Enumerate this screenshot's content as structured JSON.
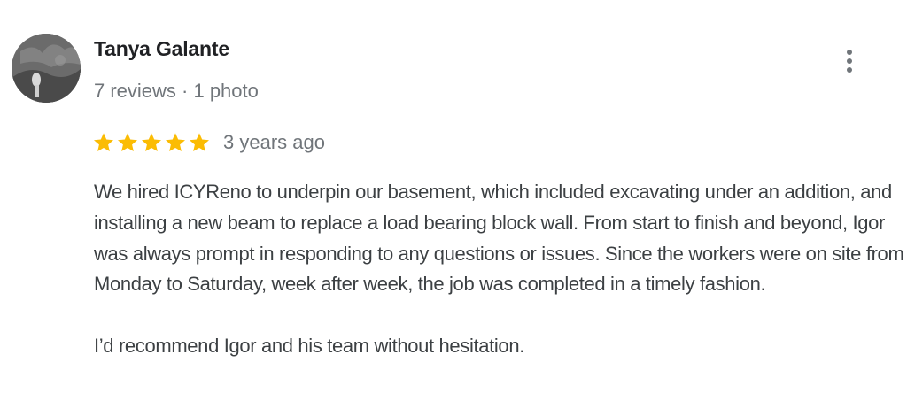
{
  "reviewer": {
    "name": "Tanya Galante",
    "meta": "7 reviews · 1 photo",
    "avatar_icon": "user-avatar-photo"
  },
  "menu": {
    "icon": "more-vert-icon"
  },
  "rating": {
    "stars": 5,
    "max": 5,
    "star_color": "#fbbc04",
    "date": "3 years ago"
  },
  "review": {
    "paragraph_1": "We hired ICYReno to underpin our basement, which included excavating under an addition, and installing a new beam to replace a load bearing block wall. From start to finish and beyond, Igor was always prompt in responding to any questions or issues. Since the workers were on site from Monday to Saturday, week after week, the job was completed in a timely fashion.",
    "paragraph_2": "I’d recommend Igor and his team without hesitation."
  }
}
